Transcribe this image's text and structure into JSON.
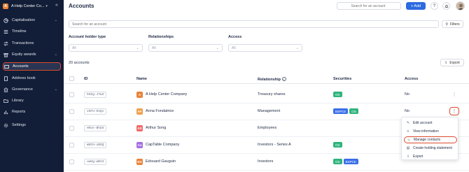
{
  "sidebar": {
    "org_initial": "A",
    "org_name": "A Help Center Co...",
    "items": [
      {
        "label": "Capitalisation"
      },
      {
        "label": "Timeline"
      },
      {
        "label": "Transactions"
      },
      {
        "label": "Equity awards"
      },
      {
        "label": "Accounts"
      },
      {
        "label": "Address book"
      },
      {
        "label": "Governance"
      },
      {
        "label": "Library"
      },
      {
        "label": "Reports"
      },
      {
        "label": "Settings"
      }
    ]
  },
  "header": {
    "title": "Accounts",
    "search_placeholder": "Search for an account",
    "add_label": "+ Add",
    "help_glyph": "?",
    "bell_glyph": "Δ"
  },
  "filters": {
    "search_placeholder": "Search for an account",
    "filters_label": "Filters",
    "groups": [
      {
        "label": "Account holder type",
        "value": "All"
      },
      {
        "label": "Relationships",
        "value": "All"
      },
      {
        "label": "Access",
        "value": "All"
      }
    ]
  },
  "summary": {
    "count": "20 accounts",
    "export_label": "Export"
  },
  "table": {
    "headers": {
      "id": "ID",
      "name": "Name",
      "relationship": "Relationship",
      "securities": "Securities",
      "access": "Access"
    },
    "rows": [
      {
        "id": "GSXg-J7w2",
        "initial": "A",
        "name": "A Help Center Company",
        "avatar_color": "#e8833a",
        "relationship": "Treasury shares",
        "securities": [
          "OS"
        ],
        "access": "No"
      },
      {
        "id": "vGFU-K1Qs",
        "initial": "AF",
        "name": "Anna Fondatrice",
        "avatar_color": "#f0a04b",
        "relationship": "Management",
        "securities": [
          "BSPCE",
          "OS"
        ],
        "access": "No"
      },
      {
        "id": "HkUs-BhUS",
        "initial": "AS",
        "name": "Arthur Song",
        "avatar_color": "#ef6b6b",
        "relationship": "Employees",
        "securities": [],
        "access": ""
      },
      {
        "id": "WUCH-xBXQ",
        "initial": "Ca",
        "name": "CapTable Company",
        "avatar_color": "#a36fe0",
        "relationship": "Investors - Series A",
        "securities": [
          "OS"
        ],
        "access": ""
      },
      {
        "id": "uwUg-wB13",
        "initial": "EG",
        "name": "Edouard Gauguin",
        "avatar_color": "#e8833a",
        "relationship": "Investors",
        "securities": [
          "OS",
          "BSPCE"
        ],
        "access": ""
      }
    ]
  },
  "menu": {
    "items": [
      {
        "label": "Edit account",
        "icon": "pencil-icon",
        "glyph": "✎"
      },
      {
        "label": "View information",
        "icon": "list-icon",
        "glyph": "≡"
      },
      {
        "label": "Manage contacts",
        "icon": "person-icon",
        "glyph": "☺"
      },
      {
        "label": "Create holding statement",
        "icon": "document-icon",
        "glyph": "▤"
      },
      {
        "label": "Export",
        "icon": "export-icon",
        "glyph": "⇩"
      }
    ]
  },
  "colors": {
    "sidebar": "#121d37",
    "primary": "#2c6be0",
    "highlight": "#d94b2e",
    "os_badge": "#2fb47c",
    "bspce_badge": "#3a6ee8"
  }
}
